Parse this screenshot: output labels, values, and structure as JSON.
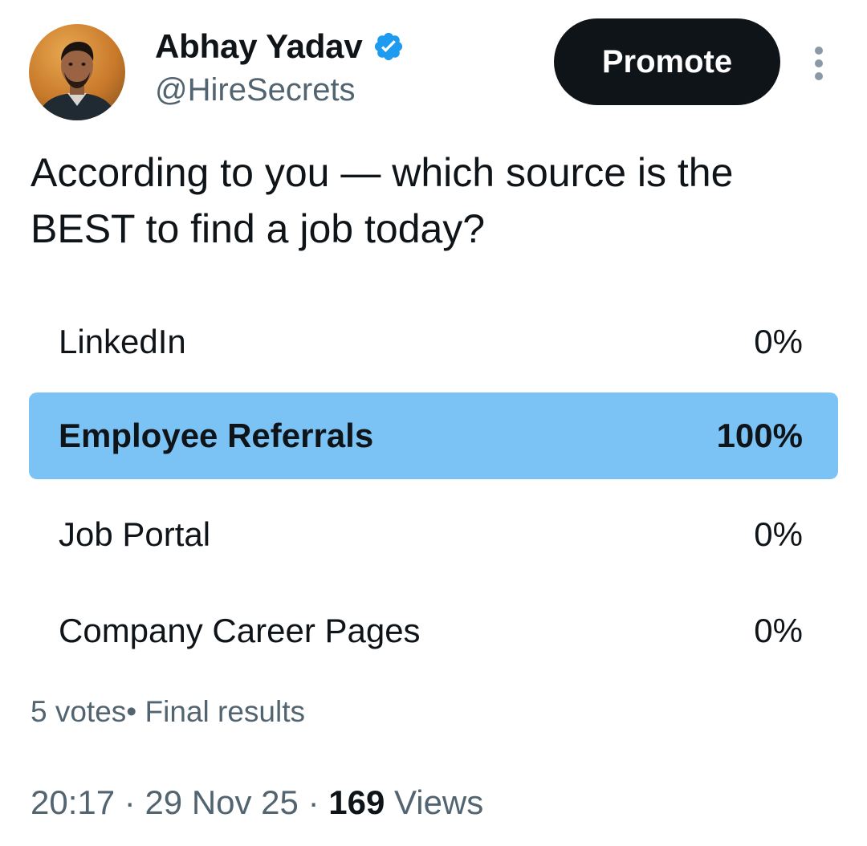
{
  "author": {
    "name": "Abhay Yadav",
    "handle": "@HireSecrets",
    "verified": true,
    "verified_color": "#1d9bf0"
  },
  "actions": {
    "promote_label": "Promote",
    "more_icon": "more-vertical-icon"
  },
  "tweet": {
    "text_line1": "According to you — which source is the",
    "text_line2": "BEST to find a job today?"
  },
  "poll": {
    "options": [
      {
        "label": "LinkedIn",
        "percent_text": "0%",
        "share": 0,
        "winner": false
      },
      {
        "label": "Employee Referrals",
        "percent_text": "100%",
        "share": 1,
        "winner": true
      },
      {
        "label": "Job Portal",
        "percent_text": "0%",
        "share": 0,
        "winner": false
      },
      {
        "label": "Company Career Pages",
        "percent_text": "0%",
        "share": 0,
        "winner": false
      }
    ],
    "winner_bar_color": "#7cc3f5",
    "votes": "5 votes",
    "separator": "•",
    "status": "Final results"
  },
  "meta": {
    "time": "20:17",
    "date": "29 Nov 25",
    "sep": " · ",
    "views_count": "169",
    "views_label": "Views"
  }
}
